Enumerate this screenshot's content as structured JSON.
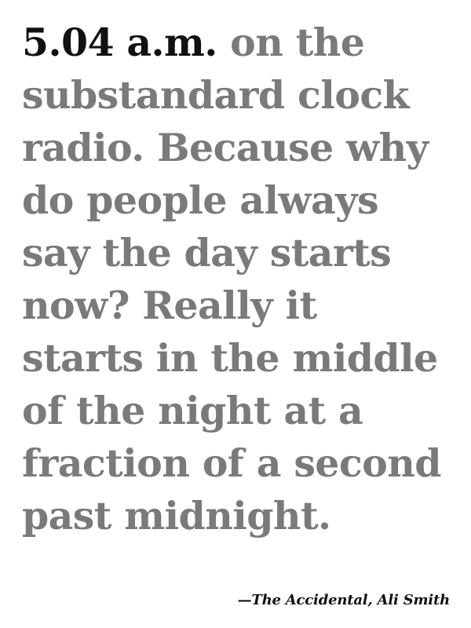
{
  "quote": {
    "lead": "5.04 a.m.",
    "lines": [
      " on the",
      "substandard clock",
      "radio. Because why",
      "do people always",
      "say the day starts",
      "now? Really it",
      "starts in the middle",
      "of the night at a",
      "fraction of a second",
      "past midnight."
    ]
  },
  "attribution": {
    "dash": "—",
    "book": "The Accidental",
    "separator": ", ",
    "author": "Ali Smith"
  },
  "colors": {
    "lead_text": "#111111",
    "quote_text": "#7a7a7a",
    "background": "#ffffff"
  }
}
